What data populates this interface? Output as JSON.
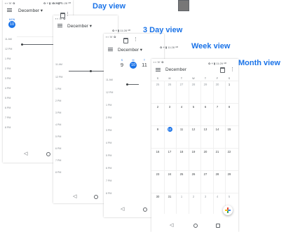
{
  "labels": {
    "day_view": "Day view",
    "three_day_view": "3 Day view",
    "week_view": "Week view",
    "month_view": "Month view"
  },
  "status": {
    "left_icons": "▪ ▪ ☏ ✿",
    "right_day": "✿ ⁴⁄ ▮ 11:28 ᴬᴹ",
    "right_3day": "✿ ⁴⁄ ▮ 11:28 ᴬᴹ",
    "right_week": "✿ ⁴⁄ ▮ 11:28 ᴬᴹ",
    "right_month": "✿ ⁴⁄ ▮ 11:29 ᴬᴹ"
  },
  "day": {
    "month": "December",
    "weekday": "MON",
    "date": "10",
    "hours": [
      "11 AM",
      "12 PM",
      "1 PM",
      "2 PM",
      "3 PM",
      "4 PM",
      "5 PM",
      "6 PM",
      "7 PM",
      "8 PM"
    ]
  },
  "three_day": {
    "month": "December",
    "hours": [
      "11 AM",
      "12 PM",
      "1 PM",
      "2 PM",
      "3 PM",
      "4 PM",
      "5 PM",
      "6 PM",
      "7 PM",
      "8 PM"
    ]
  },
  "week": {
    "month": "December",
    "days": [
      {
        "name": "S",
        "num": "9"
      },
      {
        "name": "M",
        "num": "10"
      },
      {
        "name": "T",
        "num": "11"
      }
    ],
    "hours": [
      "11 AM",
      "12 PM",
      "1 PM",
      "2 PM",
      "3 PM",
      "4 PM",
      "5 PM",
      "6 PM",
      "7 PM",
      "8 PM",
      "9 PM"
    ]
  },
  "month": {
    "month": "December",
    "weekdays": [
      "S",
      "M",
      "T",
      "W",
      "T",
      "F",
      "S"
    ],
    "rows": [
      [
        "25",
        "26",
        "27",
        "28",
        "29",
        "30",
        "1"
      ],
      [
        "2",
        "3",
        "4",
        "5",
        "6",
        "7",
        "8"
      ],
      [
        "9",
        "10",
        "11",
        "12",
        "13",
        "14",
        "15"
      ],
      [
        "16",
        "17",
        "18",
        "19",
        "20",
        "21",
        "22"
      ],
      [
        "23",
        "24",
        "25",
        "26",
        "27",
        "28",
        "29"
      ],
      [
        "30",
        "31",
        "1",
        "2",
        "3",
        "4",
        "5"
      ]
    ],
    "dim_first_row": 6,
    "today": "10",
    "fab_icon": "plus-icon"
  },
  "nav": {
    "back": "◁",
    "home": "○",
    "recent": "□"
  },
  "colors": {
    "accent": "#1a73e8",
    "label": "#1a73e8"
  }
}
